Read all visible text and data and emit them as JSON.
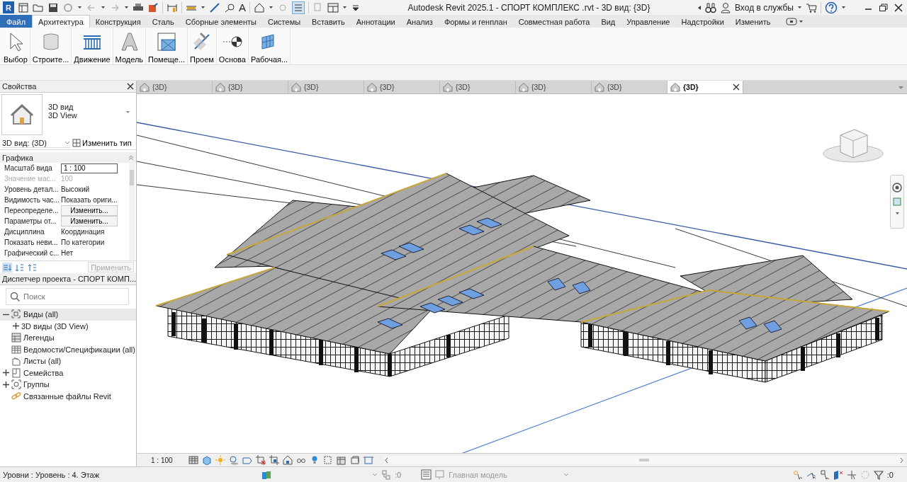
{
  "title_bar": {
    "logo": "R",
    "text_tool": "A",
    "title": "Autodesk Revit 2025.1 - СПОРТ КОМПЛЕКС .rvt - 3D вид: {3D}",
    "sign_in": "Вход в службы"
  },
  "ribbon_tabs": [
    {
      "label": "Файл",
      "kind": "file",
      "selected": false
    },
    {
      "label": "Архитектура",
      "kind": "tab",
      "selected": true
    },
    {
      "label": "Конструкция",
      "kind": "tab",
      "selected": false
    },
    {
      "label": "Сталь",
      "kind": "tab",
      "selected": false
    },
    {
      "label": "Сборные элементы",
      "kind": "tab",
      "selected": false
    },
    {
      "label": "Системы",
      "kind": "tab",
      "selected": false
    },
    {
      "label": "Вставить",
      "kind": "tab",
      "selected": false
    },
    {
      "label": "Аннотации",
      "kind": "tab",
      "selected": false
    },
    {
      "label": "Анализ",
      "kind": "tab",
      "selected": false
    },
    {
      "label": "Формы и генплан",
      "kind": "tab",
      "selected": false
    },
    {
      "label": "Совместная работа",
      "kind": "tab",
      "selected": false
    },
    {
      "label": "Вид",
      "kind": "tab",
      "selected": false
    },
    {
      "label": "Управление",
      "kind": "tab",
      "selected": false
    },
    {
      "label": "Надстройки",
      "kind": "tab",
      "selected": false
    },
    {
      "label": "Изменить",
      "kind": "tab",
      "selected": false
    }
  ],
  "ribbon_tools": [
    {
      "label": "Выбор"
    },
    {
      "label": "Строите..."
    },
    {
      "label": "Движение"
    },
    {
      "label": "Модель"
    },
    {
      "label": "Помеще..."
    },
    {
      "label": "Проем"
    },
    {
      "label": "Основа"
    },
    {
      "label": "Рабочая..."
    }
  ],
  "properties": {
    "title": "Свойства",
    "type_name": "3D вид",
    "type_subname": "3D View",
    "instance": "3D вид: (3D)",
    "edit_type": "Изменить тип",
    "group": "Графика",
    "rows": [
      {
        "name": "Масштаб вида",
        "value": "1 : 100",
        "kind": "input"
      },
      {
        "name": "Значение мас...",
        "value": "100",
        "kind": "disabled"
      },
      {
        "name": "Уровень детал...",
        "value": "Высокий",
        "kind": "text"
      },
      {
        "name": "Видимость час...",
        "value": "Показать ориги...",
        "kind": "text"
      },
      {
        "name": "Переопределе...",
        "value": "Изменить...",
        "kind": "button"
      },
      {
        "name": "Параметры от...",
        "value": "Изменить...",
        "kind": "button"
      },
      {
        "name": "Дисциплина",
        "value": "Координация",
        "kind": "text"
      },
      {
        "name": "Показать неви...",
        "value": "По категории",
        "kind": "text"
      },
      {
        "name": "Графический с...",
        "value": "Нет",
        "kind": "text"
      }
    ],
    "apply": "Применить"
  },
  "project_browser": {
    "title": "Диспетчер проекта - СПОРТ КОМП...",
    "search_placeholder": "Поиск",
    "tree": [
      {
        "label": "Виды (all)",
        "expanded": true,
        "selected": true,
        "children": [
          {
            "label": "3D виды (3D View)",
            "expanded": false,
            "selected": false
          }
        ]
      },
      {
        "label": "Легенды",
        "selected": false
      },
      {
        "label": "Ведомости/Спецификации (all)",
        "selected": false
      },
      {
        "label": "Листы (all)",
        "selected": false
      },
      {
        "label": "Семейства",
        "expanded": false,
        "selected": false
      },
      {
        "label": "Группы",
        "expanded": false,
        "selected": false
      },
      {
        "label": "Связанные файлы Revit",
        "selected": false
      }
    ]
  },
  "view_tabs": [
    {
      "label": "{3D}",
      "selected": false
    },
    {
      "label": "{3D}",
      "selected": false
    },
    {
      "label": "{3D}",
      "selected": false
    },
    {
      "label": "{3D}",
      "selected": false
    },
    {
      "label": "{3D}",
      "selected": false
    },
    {
      "label": "{3D}",
      "selected": false
    },
    {
      "label": "{3D}",
      "selected": false
    },
    {
      "label": "{3D}",
      "selected": true
    }
  ],
  "view_bar": {
    "scale": "1 : 100"
  },
  "status_bar": {
    "text": "Уровни : Уровень : 4. Этаж",
    "workset_count": ":0",
    "model": "Главная модель",
    "filter_count": ":0"
  }
}
